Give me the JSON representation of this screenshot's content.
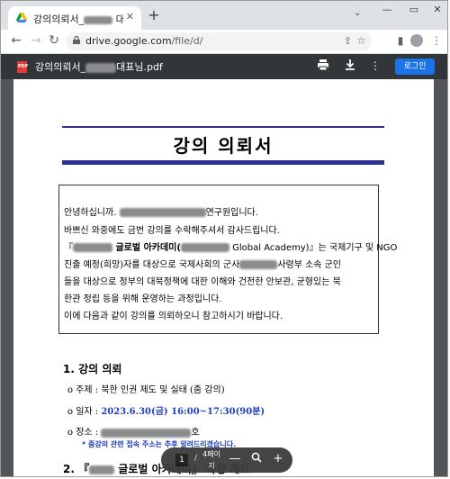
{
  "browser": {
    "tab_title": "강의의뢰서_",
    "tab_title_suffix": "대표님.pdf",
    "tab_close": "✕",
    "new_tab": "+",
    "url_host": "drive.google.com",
    "url_path": "/file/d/"
  },
  "viewer": {
    "file_name": "강의의뢰서_",
    "file_name_suffix": "대표님.pdf",
    "login_label": "로그인"
  },
  "doc": {
    "heading": "강의 의뢰서",
    "para": [
      {
        "prefix": "안녕하십니까. ",
        "suffix": "연구원입니다."
      },
      {
        "text": "바쁘신 와중에도 금번 강의를 수락해주셔서 감사드립니다."
      },
      {
        "prefix": "『",
        "mid": " 글로벌 아카데미(",
        "suffix": " Global Academy)』는 국제기구 및 NGO"
      },
      {
        "prefix": "진출 예정(희망)자를 대상으로 국제사회의   군사",
        "suffix": "사령부 소속 군인"
      },
      {
        "text": "들을 대상으로 정부의 대북정책에 대한 이해와 건전한 안보관, 균형있는 북"
      },
      {
        "text": "한관 정립 등을 위해 운영하는 과정입니다."
      },
      {
        "text": "이에 다음과 같이 강의를 의뢰하오니 참고하시기 바랍니다."
      }
    ],
    "section1": "1. 강의 의뢰",
    "item_topic_label": "o 주제 : ",
    "item_topic": "북한 인권 제도 및 실태 (줌 강의)",
    "item_date_label": "o 일자 : ",
    "item_date": "2023.6.30(금) 16:00~17:30(90분)",
    "item_place_label": "o 장소 : ",
    "item_place_suffix": "호",
    "note": "* 줌강의 관련 접속 주소는 추후 알려드리겠습니다.",
    "section2_prefix": "2. 『",
    "section2_suffix": " 글로벌 아카데미』 과정 개요"
  },
  "pager": {
    "current": "1",
    "slash": "/",
    "total_line1": "4페이",
    "total_line2": "지"
  },
  "colors": {
    "accent": "#2e3192",
    "link_blue": "#1f3fbf",
    "login_blue": "#1a73e8",
    "viewer_dark": "#323639"
  }
}
